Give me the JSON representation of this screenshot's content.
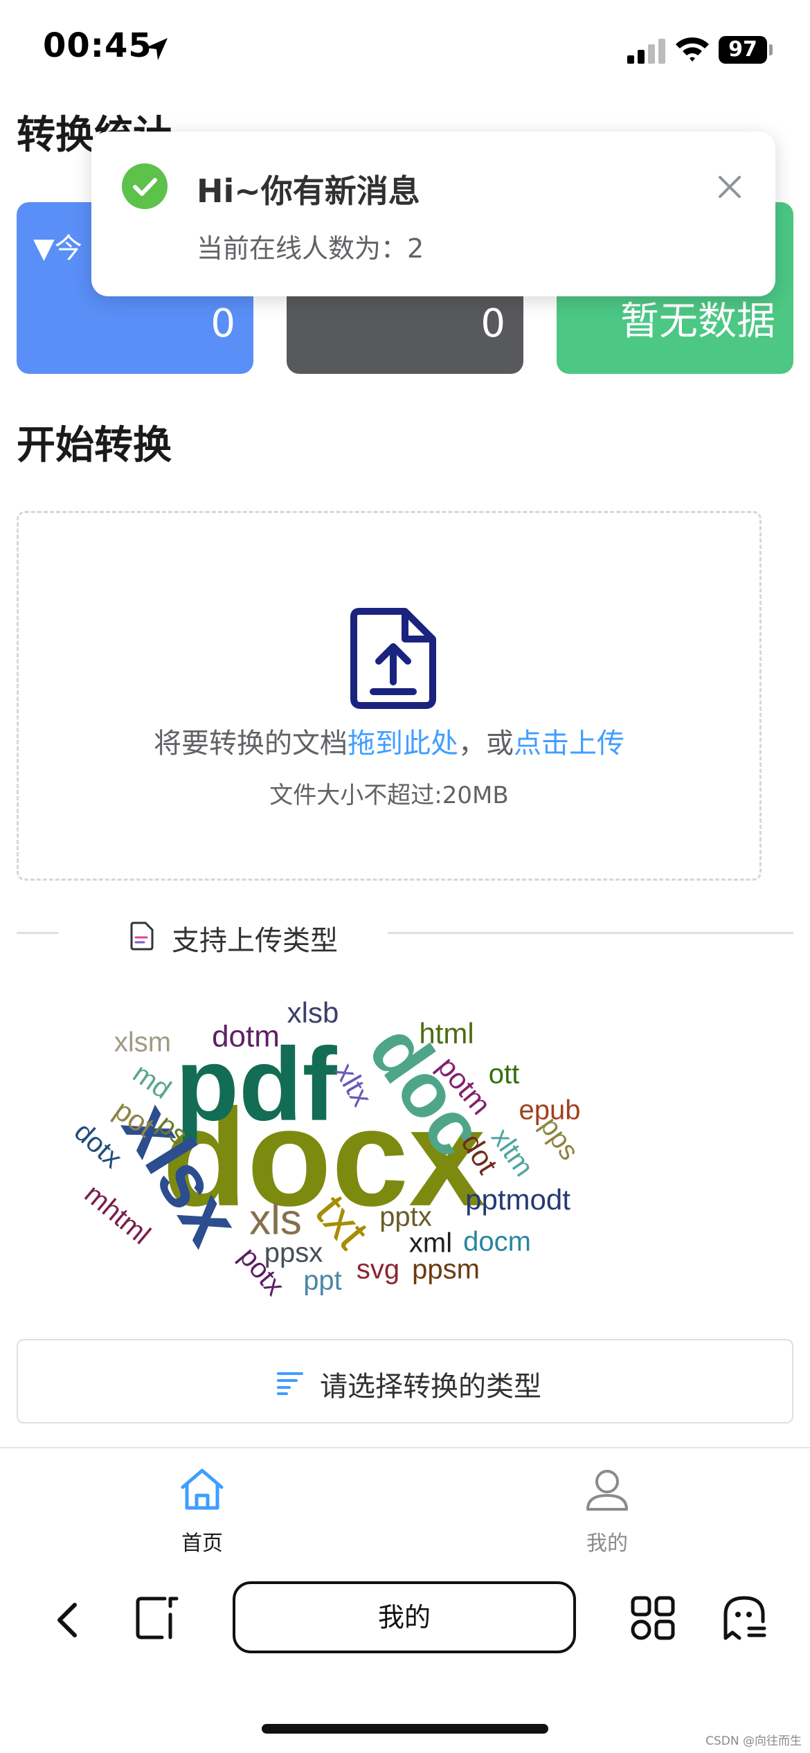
{
  "status_bar": {
    "time": "00:45",
    "battery": "97"
  },
  "stats": {
    "title": "转换统计",
    "cards": [
      {
        "label": "▼今",
        "value": "0"
      },
      {
        "label": "",
        "value": "0"
      },
      {
        "label": "",
        "value": "暂无数据"
      }
    ]
  },
  "notification": {
    "title": "Hi~你有新消息",
    "body": "当前在线人数为：2"
  },
  "convert": {
    "title": "开始转换",
    "upload_text_prefix": "将要转换的文档",
    "upload_drag_link": "拖到此处",
    "upload_text_sep": "，或",
    "upload_click_link": "点击上传",
    "size_hint": "文件大小不超过:20MB"
  },
  "supported": {
    "title": "支持上传类型",
    "words": [
      "docx",
      "pdf",
      "xlsx",
      "doc",
      "txt",
      "xls",
      "dotm",
      "xlsb",
      "html",
      "xlsm",
      "md",
      "pot",
      "ps",
      "dotx",
      "xltx",
      "potm",
      "ott",
      "epub",
      "pps",
      "xltm",
      "dot",
      "pptmodt",
      "pptx",
      "xml",
      "docm",
      "ppsx",
      "ppt",
      "svg",
      "ppsm",
      "potx",
      "mhtml"
    ]
  },
  "select_type": {
    "label": "请选择转换的类型"
  },
  "tabbar": {
    "home": "首页",
    "mine": "我的"
  },
  "browser": {
    "address": "我的"
  },
  "watermark": "CSDN @向往而生",
  "colors": {
    "accent_blue": "#409eff",
    "card_blue": "#5a8ff7",
    "card_gray": "#58595c",
    "card_green": "#4cc784",
    "success_green": "#5cc24a"
  }
}
